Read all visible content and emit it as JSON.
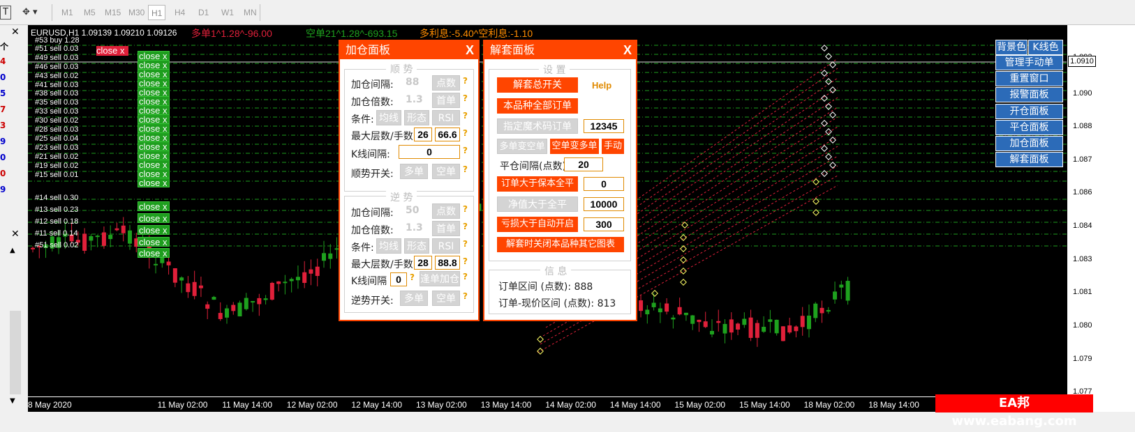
{
  "toolbar": {
    "t_label": "T",
    "timeframes": [
      "M1",
      "M5",
      "M15",
      "M30",
      "H1",
      "H4",
      "D1",
      "W1",
      "MN"
    ],
    "active": "H1"
  },
  "left_panel": {
    "numbers": [
      "个",
      "4",
      "0",
      "5",
      "7",
      "3",
      "9",
      "0",
      "0",
      "9"
    ],
    "number_colors": [
      "#000000",
      "#cc0000",
      "#0000cc",
      "#0000cc",
      "#cc0000",
      "#cc0000",
      "#0000cc",
      "#0000cc",
      "#cc0000",
      "#0000cc"
    ]
  },
  "chart": {
    "symbol_header": "EURUSD,H1  1.09139 1.09210 1.09126",
    "buy_info": "多单1^1.28^-96.00",
    "sell_info": "空单21^1.28^-693.15",
    "interest_info": "多利息:-5.40^空利息:-1.10",
    "close_red": "close x",
    "close_label": "close x",
    "orders": [
      "#53 buy 1.28",
      "#51 sell 0.03",
      "#49 sell 0.03",
      "#46 sell 0.03",
      "#43 sell 0.02",
      "#41 sell 0.03",
      "#38 sell 0.03",
      "#35 sell 0.03",
      "#33 sell 0.03",
      "#30 sell 0.02",
      "#28 sell 0.03",
      "#25 sell 0.04",
      "#23 sell 0.03",
      "#21 sell 0.02",
      "#19 sell 0.02",
      "#15 sell 0.01",
      "#14 sell 0.30",
      "#13 sell 0.23",
      "#12 sell 0.18",
      "#11 sell 0.14",
      "#51 sell 0.02"
    ],
    "prices": [
      "1.092",
      "1.0910",
      "1.090",
      "1.088",
      "1.087",
      "1.086",
      "1.084",
      "1.083",
      "1.081",
      "1.080",
      "1.079",
      "1.077"
    ],
    "price_box": "1.0910",
    "x_labels": [
      "8 May 2020",
      "11 May 02:00",
      "11 May 14:00",
      "12 May 02:00",
      "12 May 14:00",
      "13 May 02:00",
      "13 May 14:00",
      "14 May 02:00",
      "14 May 14:00",
      "15 May 02:00",
      "15 May 14:00",
      "18 May 02:00",
      "18 May 14:00"
    ],
    "colors": {
      "bull": "#1ea11e",
      "bear": "#e0203a",
      "grid_green": "#1e9e1e",
      "panel_orange": "#ff4500"
    }
  },
  "add_panel": {
    "title": "加仓面板",
    "close": "X",
    "trend_title": "顺  势",
    "counter_title": "逆  势",
    "q": "?",
    "trend": {
      "interval_label": "加仓间隔:",
      "interval_value": "88",
      "interval_btn": "点数",
      "multiplier_label": "加仓倍数:",
      "multiplier_value": "1.3",
      "multiplier_btn": "首单",
      "condition_label": "条件:",
      "cond_btns": [
        "均线",
        "形态",
        "RSI"
      ],
      "max_label": "最大层数/手数",
      "max_layers": "26",
      "max_lots": "66.6",
      "k_label": "K线间隔:",
      "k_value": "0",
      "switch_label": "顺势开关:",
      "switch_btns": [
        "多单",
        "空单"
      ]
    },
    "counter": {
      "interval_label": "加仓间隔:",
      "interval_value": "50",
      "interval_btn": "点数",
      "multiplier_label": "加仓倍数:",
      "multiplier_value": "1.3",
      "multiplier_btn": "首单",
      "condition_label": "条件:",
      "cond_btns": [
        "均线",
        "形态",
        "RSI"
      ],
      "max_label": "最大层数/手数",
      "max_layers": "28",
      "max_lots": "88.8",
      "k_label": "K线间隔",
      "k_value": "0",
      "single_btn": "逢单加仓",
      "switch_label": "逆势开关:",
      "switch_btns": [
        "多单",
        "空单"
      ]
    }
  },
  "unlock_panel": {
    "title": "解套面板",
    "close": "X",
    "settings_title": "设  置",
    "help": "Help",
    "master_switch": "解套总开关",
    "all_orders": "本品种全部订单",
    "magic_btn": "指定魔术码订单",
    "magic_value": "12345",
    "long_to_short": "多单变空单",
    "short_to_long": "空单变多单",
    "manual": "手动",
    "close_interval_label": "平仓间隔(点数)",
    "close_interval_value": "20",
    "breakeven_btn": "订单大于保本全平",
    "breakeven_value": "0",
    "net_btn": "净值大于全平",
    "net_value": "10000",
    "loss_btn": "亏损大于自动开启",
    "loss_value": "300",
    "close_charts_btn": "解套时关闭本品种其它图表",
    "info_title": "信  息",
    "info_range": "订单区间 (点数): 888",
    "info_price_range": "订单-现价区间 (点数): 813"
  },
  "right_buttons": {
    "bg_color": "背景色",
    "k_color": "K线色",
    "items": [
      "管理手动单",
      "重置窗口",
      "报警面板",
      "开仓面板",
      "平仓面板",
      "加仓面板",
      "解套面板"
    ]
  },
  "watermark": "EA邦 www.eabang.com"
}
